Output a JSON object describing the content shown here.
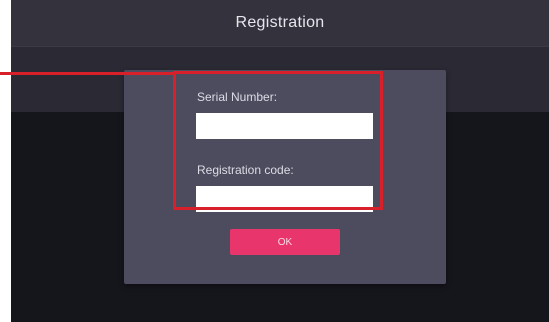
{
  "header": {
    "title": "Registration"
  },
  "dialog": {
    "serial_number_label": "Serial Number:",
    "serial_number_value": "",
    "registration_code_label": "Registration code:",
    "registration_code_value": "",
    "ok_label": "OK"
  },
  "colors": {
    "accent": "#e8356b",
    "highlight_annotation": "#d8202a",
    "dialog_bg": "#4d4c5e",
    "titlebar_bg": "#34323d"
  }
}
